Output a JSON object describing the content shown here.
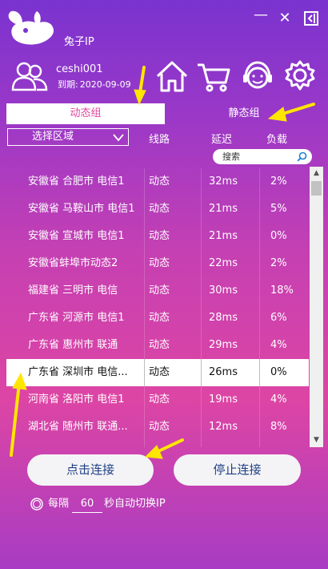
{
  "app": {
    "title": "兔子IP"
  },
  "window_controls": {
    "minimize": "—",
    "close": "✕",
    "exit": "⇥"
  },
  "user": {
    "name": "ceshi001",
    "expire_label": "到期:",
    "expire_date": "2020-09-09"
  },
  "toolbar": {
    "icons": [
      "home-icon",
      "cart-icon",
      "support-icon",
      "settings-icon"
    ]
  },
  "tabs": {
    "dynamic": "动态组",
    "static": "静态组"
  },
  "filter": {
    "region_label": "选择区域"
  },
  "columns": {
    "line": "线路",
    "latency": "延迟",
    "load": "负载"
  },
  "search": {
    "placeholder": "搜索"
  },
  "list": {
    "rows": [
      {
        "name": "安徽省 合肥市 电信1",
        "line": "动态",
        "latency": "32ms",
        "load": "2%"
      },
      {
        "name": "安徽省 马鞍山市 电信1",
        "line": "动态",
        "latency": "21ms",
        "load": "5%"
      },
      {
        "name": "安徽省 宣城市 电信1",
        "line": "动态",
        "latency": "21ms",
        "load": "0%"
      },
      {
        "name": "安徽省蚌埠市动态2",
        "line": "动态",
        "latency": "22ms",
        "load": "2%"
      },
      {
        "name": "福建省 三明市 电信",
        "line": "动态",
        "latency": "30ms",
        "load": "18%"
      },
      {
        "name": "广东省  河源市 电信1",
        "line": "动态",
        "latency": "28ms",
        "load": "6%"
      },
      {
        "name": "广东省  惠州市 联通",
        "line": "动态",
        "latency": "29ms",
        "load": "4%"
      },
      {
        "name": "广东省 深圳市 电信...",
        "line": "动态",
        "latency": "26ms",
        "load": "0%",
        "selected": true
      },
      {
        "name": "河南省 洛阳市 电信1",
        "line": "动态",
        "latency": "19ms",
        "load": "4%"
      },
      {
        "name": "湖北省 随州市 联通...",
        "line": "动态",
        "latency": "12ms",
        "load": "8%"
      }
    ]
  },
  "actions": {
    "connect": "点击连接",
    "stop": "停止连接"
  },
  "auto_switch": {
    "prefix": "每隔",
    "interval": "60",
    "suffix": "秒自动切换IP"
  },
  "colors": {
    "accent": "#e0479e",
    "arrow": "#ffe600",
    "button_text": "#1f3f85"
  }
}
